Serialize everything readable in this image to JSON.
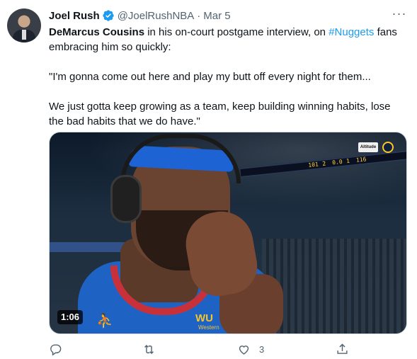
{
  "tweet": {
    "author_name": "Joel Rush",
    "handle": "@JoelRushNBA",
    "separator": "·",
    "date": "Mar 5",
    "more_label": "···",
    "line1_bold": "DeMarcus Cousins",
    "line1_text": " in his on-court postgame interview, on ",
    "line1_hashtag": "#Nuggets",
    "line1_tail": " fans",
    "line2": "embracing him so quickly:",
    "quote1": "\"I'm gonna come out here and play my butt off every night for them...",
    "quote2": "We just gotta keep growing as a team, keep building winning habits, lose",
    "quote3": "the bad habits that we do have.\""
  },
  "media": {
    "duration": "1:06",
    "sponsor_logo": "Altitude",
    "jersey_text": "WU",
    "jersey_sub": "Western",
    "scoreboard": [
      "101",
      "2",
      "0.0",
      "1",
      "116"
    ]
  },
  "actions": {
    "reply_icon": "reply-icon",
    "retweet_icon": "retweet-icon",
    "like_icon": "heart-icon",
    "like_count": "3",
    "share_icon": "share-icon"
  },
  "colors": {
    "accent": "#1d9bf0",
    "muted": "#536471",
    "text": "#0f1419"
  }
}
